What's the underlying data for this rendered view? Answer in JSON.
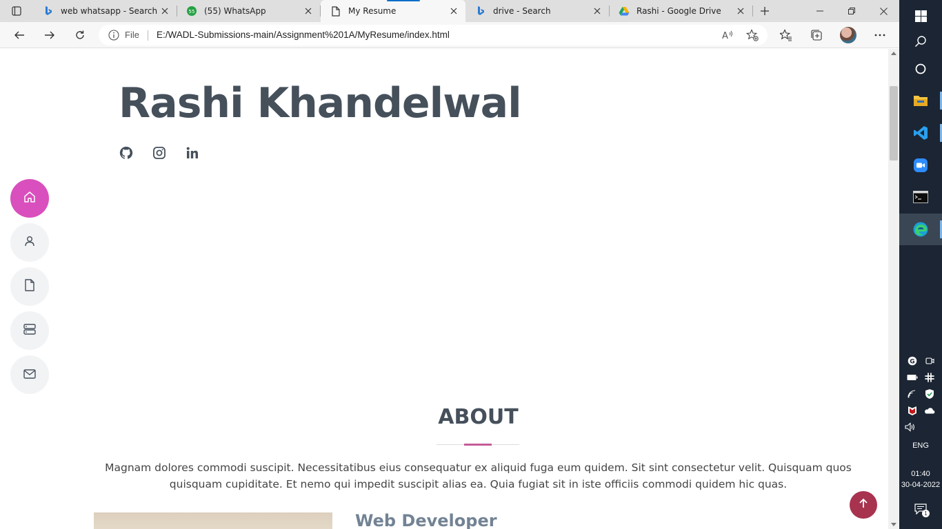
{
  "browser": {
    "tabs": [
      {
        "title": "web whatsapp - Search",
        "icon": "bing-icon"
      },
      {
        "title": "(55) WhatsApp",
        "icon": "whatsapp-icon"
      },
      {
        "title": "My Resume",
        "icon": "page-icon",
        "active": true
      },
      {
        "title": "drive - Search",
        "icon": "bing-icon"
      },
      {
        "title": "Rashi - Google Drive",
        "icon": "google-drive-icon"
      }
    ],
    "address": {
      "scheme_label": "File",
      "url": "E:/WADL-Submissions-main/Assignment%201A/MyResume/index.html"
    }
  },
  "page": {
    "name": "Rashi Khandelwal",
    "socials": [
      "github-icon",
      "instagram-icon",
      "linkedin-icon"
    ],
    "nav": [
      "home-icon",
      "user-icon",
      "document-icon",
      "server-icon",
      "mail-icon"
    ],
    "about": {
      "title": "ABOUT",
      "text": "Magnam dolores commodi suscipit. Necessitatibus eius consequatur ex aliquid fuga eum quidem. Sit sint consectetur velit. Quisquam quos quisquam cupiditate. Et nemo qui impedit suscipit alias ea. Quia fugiat sit in iste officiis commodi quidem hic quas.",
      "subheading": "Web Developer"
    },
    "colors": {
      "accent": "#d94fbd",
      "heading": "#45505b",
      "back_to_top": "#a7334f"
    }
  },
  "taskbar": {
    "language": "ENG",
    "time": "01:40",
    "date": "30-04-2022",
    "notification_count": "1"
  }
}
